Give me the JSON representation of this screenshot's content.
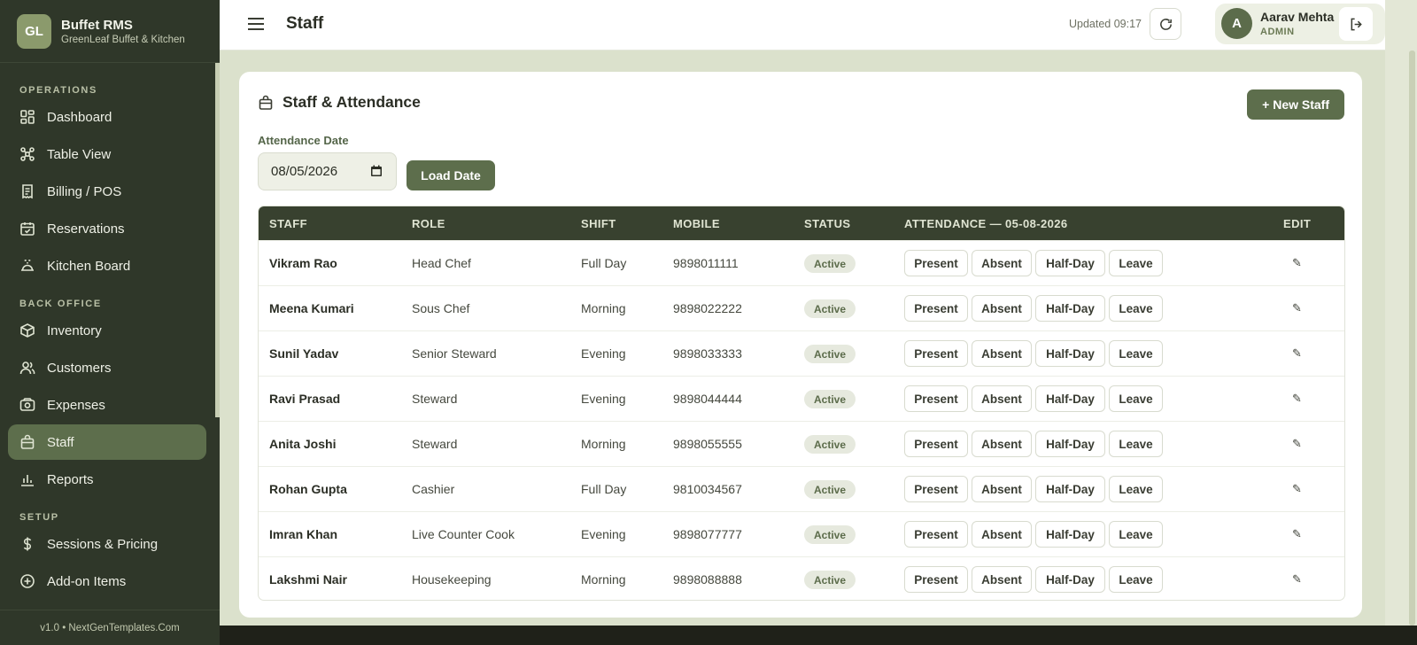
{
  "brand": {
    "logo": "GL",
    "title": "Buffet RMS",
    "subtitle": "GreenLeaf Buffet & Kitchen"
  },
  "sidebar": {
    "sections": [
      {
        "label": "OPERATIONS",
        "items": [
          {
            "label": "Dashboard",
            "icon": "dashboard-icon"
          },
          {
            "label": "Table View",
            "icon": "table-icon"
          },
          {
            "label": "Billing / POS",
            "icon": "receipt-icon"
          },
          {
            "label": "Reservations",
            "icon": "calendar-icon"
          },
          {
            "label": "Kitchen Board",
            "icon": "cloche-icon"
          }
        ]
      },
      {
        "label": "BACK OFFICE",
        "items": [
          {
            "label": "Inventory",
            "icon": "box-icon"
          },
          {
            "label": "Customers",
            "icon": "users-icon"
          },
          {
            "label": "Expenses",
            "icon": "cash-icon"
          },
          {
            "label": "Staff",
            "icon": "bag-icon",
            "active": true
          },
          {
            "label": "Reports",
            "icon": "bar-chart-icon"
          }
        ]
      },
      {
        "label": "SETUP",
        "items": [
          {
            "label": "Sessions & Pricing",
            "icon": "dollar-icon"
          },
          {
            "label": "Add-on Items",
            "icon": "plus-circle-icon"
          }
        ]
      }
    ],
    "footer": "v1.0 • NextGenTemplates.Com"
  },
  "topbar": {
    "title": "Staff",
    "updated": "Updated 09:17",
    "user": {
      "initial": "A",
      "name": "Aarav Mehta",
      "role": "ADMIN"
    }
  },
  "card": {
    "title": "Staff & Attendance",
    "new_button": "+ New Staff",
    "date_label": "Attendance Date",
    "date_value": "08/05/2026",
    "load_button": "Load Date"
  },
  "table": {
    "headers": {
      "staff": "STAFF",
      "role": "ROLE",
      "shift": "SHIFT",
      "mobile": "MOBILE",
      "status": "STATUS",
      "attendance": "ATTENDANCE — 05-08-2026",
      "edit": "EDIT"
    },
    "attendance_options": [
      "Present",
      "Absent",
      "Half-Day",
      "Leave"
    ],
    "edit_glyph": "✎",
    "rows": [
      {
        "name": "Vikram Rao",
        "role": "Head Chef",
        "shift": "Full Day",
        "mobile": "9898011111",
        "status": "Active"
      },
      {
        "name": "Meena Kumari",
        "role": "Sous Chef",
        "shift": "Morning",
        "mobile": "9898022222",
        "status": "Active"
      },
      {
        "name": "Sunil Yadav",
        "role": "Senior Steward",
        "shift": "Evening",
        "mobile": "9898033333",
        "status": "Active"
      },
      {
        "name": "Ravi Prasad",
        "role": "Steward",
        "shift": "Evening",
        "mobile": "9898044444",
        "status": "Active"
      },
      {
        "name": "Anita Joshi",
        "role": "Steward",
        "shift": "Morning",
        "mobile": "9898055555",
        "status": "Active"
      },
      {
        "name": "Rohan Gupta",
        "role": "Cashier",
        "shift": "Full Day",
        "mobile": "9810034567",
        "status": "Active"
      },
      {
        "name": "Imran Khan",
        "role": "Live Counter Cook",
        "shift": "Evening",
        "mobile": "9898077777",
        "status": "Active"
      },
      {
        "name": "Lakshmi Nair",
        "role": "Housekeeping",
        "shift": "Morning",
        "mobile": "9898088888",
        "status": "Active"
      }
    ]
  },
  "colors": {
    "sidebar": "#2f3729",
    "accent": "#5d6e4c",
    "header": "#38412f",
    "background": "#dbe1cc"
  }
}
